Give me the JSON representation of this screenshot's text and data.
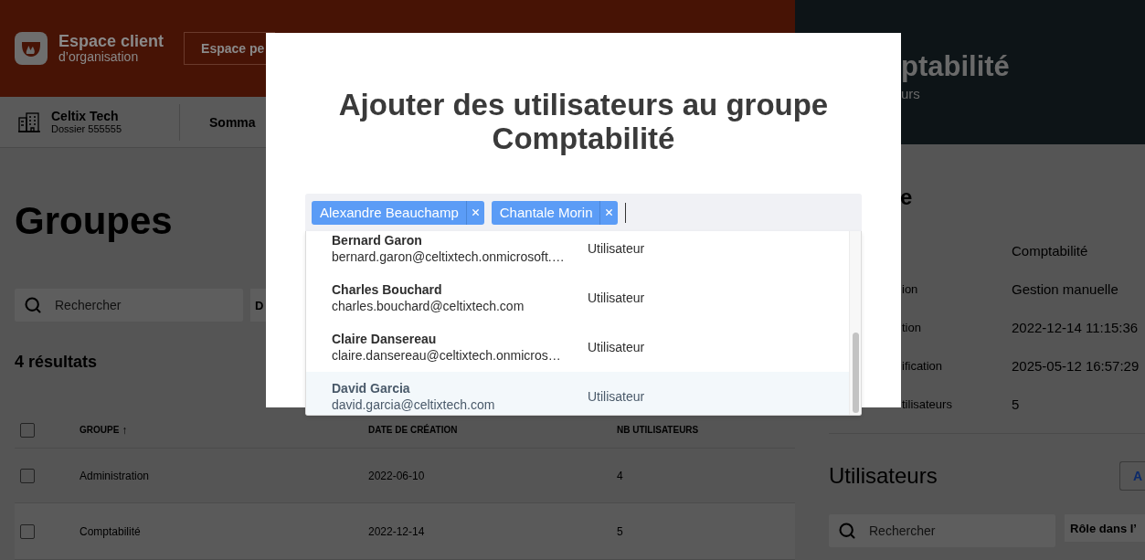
{
  "header": {
    "brand_title": "Espace client",
    "brand_subtitle": "d’organisation",
    "switch_button": "Espace pe"
  },
  "org_bar": {
    "name": "Celtix Tech",
    "file": "Dossier 555555",
    "nav_item": "Somma"
  },
  "page": {
    "title": "Groupes",
    "search": {
      "placeholder": "Rechercher"
    },
    "filter": "D",
    "results": "4 résultats",
    "table": {
      "select_all_checked": false,
      "columns": [
        {
          "label": "GROUPE",
          "sort_mark": "↑"
        },
        {
          "label": "DATE DE CRÉATION"
        },
        {
          "label": "NB UTILISATEURS"
        }
      ],
      "rows": [
        {
          "checked": false,
          "cells": [
            "Administration",
            "2022-06-10",
            "4"
          ]
        },
        {
          "checked": false,
          "cells": [
            "Comptabilité",
            "2022-12-14",
            "5"
          ]
        }
      ]
    }
  },
  "detail_panel": {
    "title": "ptabilité",
    "subtitle": "urs",
    "section_title": "e",
    "fields": [
      {
        "value": "Comptabilité"
      },
      {
        "label": "ion",
        "value": "Gestion manuelle"
      },
      {
        "label": "tion",
        "value": "2022-12-14 11:15:36"
      },
      {
        "label": "ification",
        "value": "2025-05-12 16:57:29"
      },
      {
        "label": "tilisateurs",
        "value": "5"
      }
    ],
    "users": {
      "title": "Utilisateurs",
      "add_button": "A",
      "search": {
        "placeholder": "Rechercher"
      },
      "filter": "Rôle dans l’"
    }
  },
  "modal": {
    "title": "Ajouter des utilisateurs au groupe Comptabilité",
    "selected_tags": [
      "Alexandre Beauchamp",
      "Chantale Morin"
    ],
    "options": [
      {
        "name": "Bernard Garon",
        "email": "bernard.garon@celtixtech.onmicrosoft.…",
        "role": "Utilisateur",
        "highlighted": false
      },
      {
        "name": "Charles Bouchard",
        "email": "charles.bouchard@celtixtech.com",
        "role": "Utilisateur",
        "highlighted": false
      },
      {
        "name": "Claire Dansereau",
        "email": "claire.dansereau@celtixtech.onmicros…",
        "role": "Utilisateur",
        "highlighted": false
      },
      {
        "name": "David Garcia",
        "email": "david.garcia@celtixtech.com",
        "role": "Utilisateur",
        "highlighted": true
      }
    ]
  }
}
